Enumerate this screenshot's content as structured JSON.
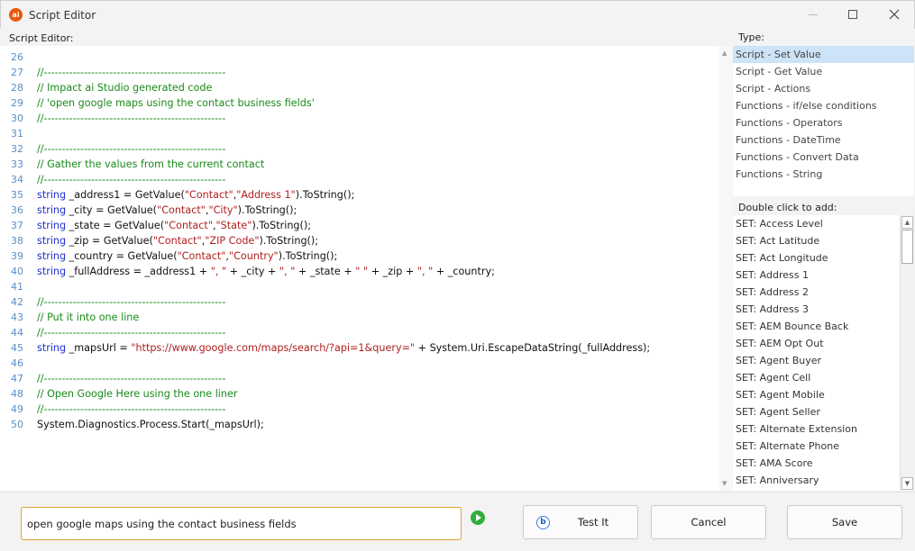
{
  "window": {
    "app_icon_text": "ai",
    "title": "Script Editor"
  },
  "editor": {
    "label": "Script Editor:",
    "lines": [
      {
        "n": "26",
        "segs": []
      },
      {
        "n": "27",
        "segs": [
          {
            "c": "cmt",
            "t": "//--------------------------------------------------"
          }
        ]
      },
      {
        "n": "28",
        "segs": [
          {
            "c": "cmt",
            "t": "// Impact ai Studio generated code"
          }
        ]
      },
      {
        "n": "29",
        "segs": [
          {
            "c": "cmt",
            "t": "// 'open google maps using the contact business fields'"
          }
        ]
      },
      {
        "n": "30",
        "segs": [
          {
            "c": "cmt",
            "t": "//--------------------------------------------------"
          }
        ]
      },
      {
        "n": "31",
        "segs": []
      },
      {
        "n": "32",
        "segs": [
          {
            "c": "cmt",
            "t": "//--------------------------------------------------"
          }
        ]
      },
      {
        "n": "33",
        "segs": [
          {
            "c": "cmt",
            "t": "// Gather the values from the current contact"
          }
        ]
      },
      {
        "n": "34",
        "segs": [
          {
            "c": "cmt",
            "t": "//--------------------------------------------------"
          }
        ]
      },
      {
        "n": "35",
        "segs": [
          {
            "c": "kw",
            "t": "string"
          },
          {
            "c": "txt",
            "t": " _address1 = GetValue("
          },
          {
            "c": "str",
            "t": "\"Contact\""
          },
          {
            "c": "txt",
            "t": ","
          },
          {
            "c": "str",
            "t": "\"Address 1\""
          },
          {
            "c": "txt",
            "t": ").ToString();"
          }
        ]
      },
      {
        "n": "36",
        "segs": [
          {
            "c": "kw",
            "t": "string"
          },
          {
            "c": "txt",
            "t": " _city = GetValue("
          },
          {
            "c": "str",
            "t": "\"Contact\""
          },
          {
            "c": "txt",
            "t": ","
          },
          {
            "c": "str",
            "t": "\"City\""
          },
          {
            "c": "txt",
            "t": ").ToString();"
          }
        ]
      },
      {
        "n": "37",
        "segs": [
          {
            "c": "kw",
            "t": "string"
          },
          {
            "c": "txt",
            "t": " _state = GetValue("
          },
          {
            "c": "str",
            "t": "\"Contact\""
          },
          {
            "c": "txt",
            "t": ","
          },
          {
            "c": "str",
            "t": "\"State\""
          },
          {
            "c": "txt",
            "t": ").ToString();"
          }
        ]
      },
      {
        "n": "38",
        "segs": [
          {
            "c": "kw",
            "t": "string"
          },
          {
            "c": "txt",
            "t": " _zip = GetValue("
          },
          {
            "c": "str",
            "t": "\"Contact\""
          },
          {
            "c": "txt",
            "t": ","
          },
          {
            "c": "str",
            "t": "\"ZIP Code\""
          },
          {
            "c": "txt",
            "t": ").ToString();"
          }
        ]
      },
      {
        "n": "39",
        "segs": [
          {
            "c": "kw",
            "t": "string"
          },
          {
            "c": "txt",
            "t": " _country = GetValue("
          },
          {
            "c": "str",
            "t": "\"Contact\""
          },
          {
            "c": "txt",
            "t": ","
          },
          {
            "c": "str",
            "t": "\"Country\""
          },
          {
            "c": "txt",
            "t": ").ToString();"
          }
        ]
      },
      {
        "n": "40",
        "segs": [
          {
            "c": "kw",
            "t": "string"
          },
          {
            "c": "txt",
            "t": " _fullAddress = _address1 + "
          },
          {
            "c": "str",
            "t": "\", \""
          },
          {
            "c": "txt",
            "t": " + _city + "
          },
          {
            "c": "str",
            "t": "\", \""
          },
          {
            "c": "txt",
            "t": " + _state + "
          },
          {
            "c": "str",
            "t": "\" \""
          },
          {
            "c": "txt",
            "t": " + _zip + "
          },
          {
            "c": "str",
            "t": "\", \""
          },
          {
            "c": "txt",
            "t": " + _country;"
          }
        ]
      },
      {
        "n": "41",
        "segs": []
      },
      {
        "n": "42",
        "segs": [
          {
            "c": "cmt",
            "t": "//--------------------------------------------------"
          }
        ]
      },
      {
        "n": "43",
        "segs": [
          {
            "c": "cmt",
            "t": "// Put it into one line"
          }
        ]
      },
      {
        "n": "44",
        "segs": [
          {
            "c": "cmt",
            "t": "//--------------------------------------------------"
          }
        ]
      },
      {
        "n": "45",
        "segs": [
          {
            "c": "kw",
            "t": "string"
          },
          {
            "c": "txt",
            "t": " _mapsUrl = "
          },
          {
            "c": "str",
            "t": "\"https://www.google.com/maps/search/?api=1&query=\""
          },
          {
            "c": "txt",
            "t": " + System.Uri.EscapeDataString(_fullAddress);"
          }
        ]
      },
      {
        "n": "46",
        "segs": []
      },
      {
        "n": "47",
        "segs": [
          {
            "c": "cmt",
            "t": "//--------------------------------------------------"
          }
        ]
      },
      {
        "n": "48",
        "segs": [
          {
            "c": "cmt",
            "t": "// Open Google Here using the one liner"
          }
        ]
      },
      {
        "n": "49",
        "segs": [
          {
            "c": "cmt",
            "t": "//--------------------------------------------------"
          }
        ]
      },
      {
        "n": "50",
        "segs": [
          {
            "c": "txt",
            "t": "System.Diagnostics.Process.Start(_mapsUrl);"
          }
        ]
      }
    ]
  },
  "type_panel": {
    "label": "Type:",
    "selected_index": 0,
    "items": [
      "Script - Set Value",
      "Script - Get Value",
      "Script - Actions",
      "Functions - if/else conditions",
      "Functions - Operators",
      "Functions - DateTime",
      "Functions - Convert Data",
      "Functions - String"
    ]
  },
  "add_panel": {
    "label": "Double click to add:",
    "items": [
      "SET: Access Level",
      "SET: Act Latitude",
      "SET: Act Longitude",
      "SET: Address 1",
      "SET: Address 2",
      "SET: Address 3",
      "SET: AEM Bounce Back",
      "SET: AEM Opt Out",
      "SET: Agent Buyer",
      "SET: Agent Cell",
      "SET: Agent Mobile",
      "SET: Agent Seller",
      "SET: Alternate Extension",
      "SET: Alternate Phone",
      "SET: AMA Score",
      "SET: Anniversary"
    ]
  },
  "bottom": {
    "prompt_value": "open google maps using the contact business fields",
    "test_label": "Test It",
    "test_icon_text": "b",
    "cancel_label": "Cancel",
    "save_label": "Save"
  },
  "colors": {
    "comment": "#1a8a1a",
    "keyword": "#1e2fd0",
    "string": "#b02020",
    "selection": "#cde3f7",
    "input_border": "#e0a032",
    "run_icon": "#2fae3a"
  }
}
